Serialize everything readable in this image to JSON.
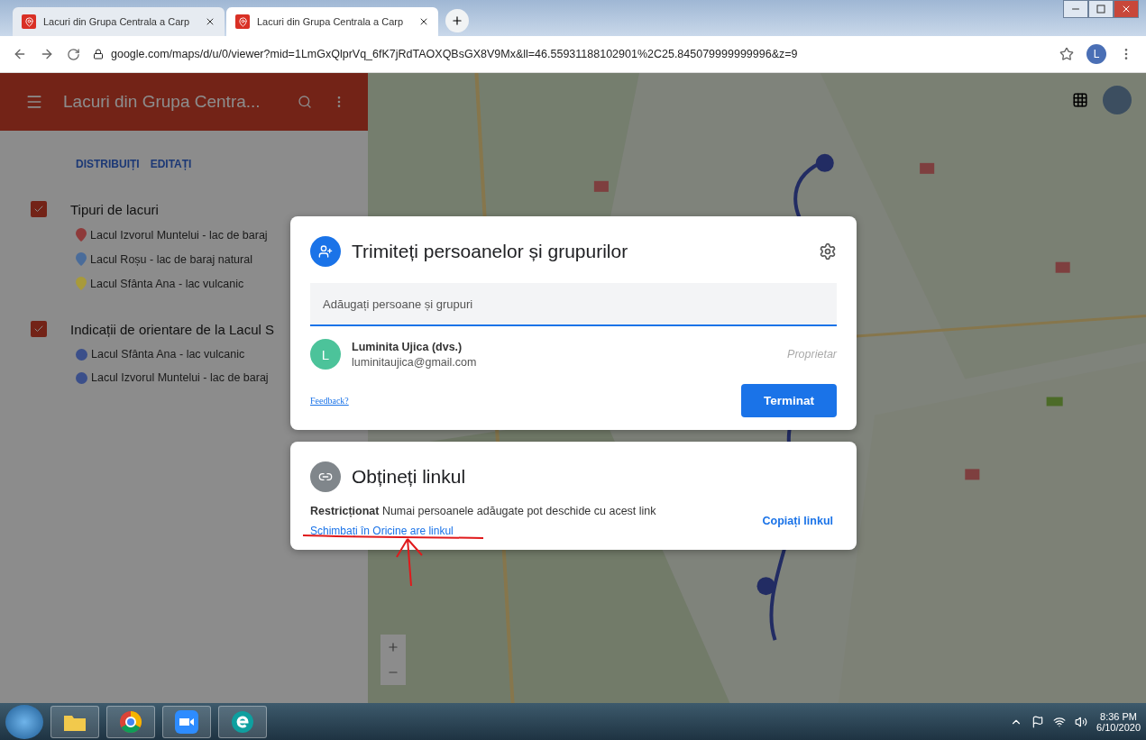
{
  "browser": {
    "tabs": [
      {
        "title": "Lacuri din Grupa Centrala a Carp",
        "selected": false
      },
      {
        "title": "Lacuri din Grupa Centrala a Carp",
        "selected": true
      }
    ],
    "url": "google.com/maps/d/u/0/viewer?mid=1LmGxQlprVq_6fK7jRdTAOXQBsGX8V9Mx&ll=46.55931188102901%2C25.845079999999996&z=9",
    "profile_initial": "L"
  },
  "sidebar": {
    "title": "Lacuri din Grupa Centra...",
    "actions": [
      "DISTRIBUIȚI",
      "EDITAȚI"
    ],
    "layers": [
      {
        "name": "Tipuri de lacuri",
        "checked": true,
        "items": [
          {
            "label": "Lacul Izvorul Muntelui - lac de baraj",
            "kind": "pin",
            "color": "#8e3a3a"
          },
          {
            "label": "Lacul Roșu - lac de baraj natural",
            "kind": "pin",
            "color": "#4a6c9a"
          },
          {
            "label": "Lacul Sfânta Ana - lac vulcanic",
            "kind": "pin",
            "color": "#a89a3a"
          }
        ]
      },
      {
        "name": "Indicații de orientare de la Lacul S",
        "checked": true,
        "items": [
          {
            "label": "Lacul Sfânta Ana - lac vulcanic",
            "kind": "waypoint",
            "color": "#3b4f8a"
          },
          {
            "label": "Lacul Izvorul Muntelui - lac de baraj",
            "kind": "waypoint",
            "color": "#3b4f8a"
          }
        ]
      }
    ]
  },
  "share_dialog": {
    "title": "Trimiteți persoanelor și grupurilor",
    "input": {
      "placeholder": "Adăugați persoane și grupuri"
    },
    "people": [
      {
        "initial": "L",
        "name": "Luminita Ujica (dvs.)",
        "email": "luminitaujica@gmail.com",
        "role": "Proprietar"
      }
    ],
    "feedback": "Feedback?",
    "done_button": "Terminat"
  },
  "link_card": {
    "title": "Obțineți linkul",
    "description": "**Restricționat** Numai persoanele adăugate pot deschide cu acest link",
    "change_link": "Schimbați în Oricine are linkul",
    "copy_link": "Copiați linkul"
  },
  "taskbar": {
    "apps": [
      {
        "kind": "folder"
      },
      {
        "kind": "chrome"
      },
      {
        "kind": "camera"
      },
      {
        "kind": "eset"
      }
    ],
    "time": "8:36 PM",
    "date": "6/10/2020"
  }
}
